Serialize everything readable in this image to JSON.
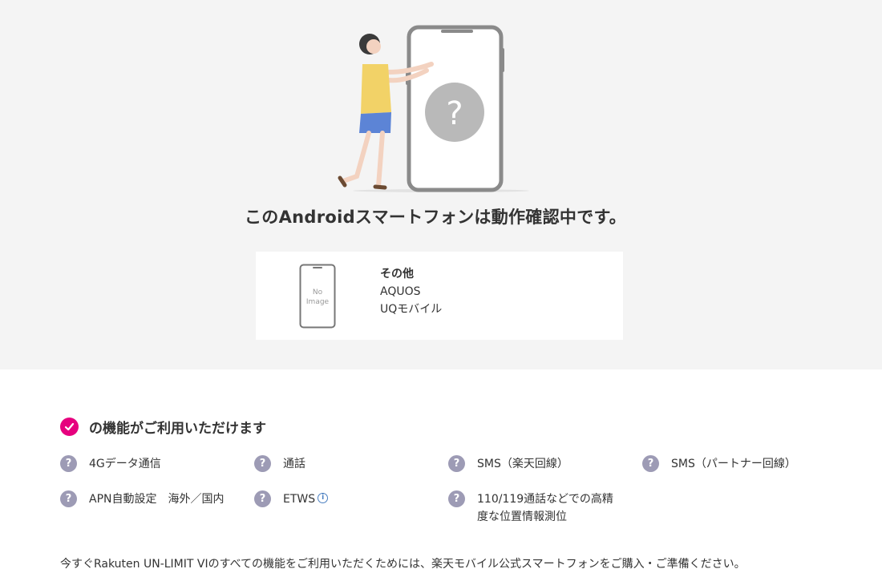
{
  "hero": {
    "headline": "このAndroidスマートフォンは動作確認中です。",
    "phone_question_mark": "?"
  },
  "device": {
    "no_image_line1": "No",
    "no_image_line2": "Image",
    "category": "その他",
    "model": "AQUOS",
    "carrier": "UQモバイル"
  },
  "features": {
    "title": "の機能がご利用いただけます",
    "items": [
      {
        "label": "4Gデータ通信",
        "icon": "question-icon"
      },
      {
        "label": "通話",
        "icon": "question-icon"
      },
      {
        "label": "SMS（楽天回線）",
        "icon": "question-icon"
      },
      {
        "label": "SMS（パートナー回線）",
        "icon": "question-icon"
      },
      {
        "label": "APN自動設定　海外／国内",
        "icon": "question-icon"
      },
      {
        "label": "ETWS",
        "icon": "question-icon",
        "info_icon": "i"
      },
      {
        "label_line1": "110/119通話などでの高精",
        "label_line2": "度な位置情報測位",
        "icon": "question-icon"
      }
    ],
    "question_glyph": "?"
  },
  "notice": "今すぐRakuten UN-LIMIT VIのすべての機能をご利用いただくためには、楽天モバイル公式スマートフォンをご購入・ご準備ください。",
  "colors": {
    "accent": "#e6007e",
    "question_badge": "#9d9bb5",
    "hero_bg": "#f4f4f4",
    "info_blue": "#4a7fc1"
  }
}
